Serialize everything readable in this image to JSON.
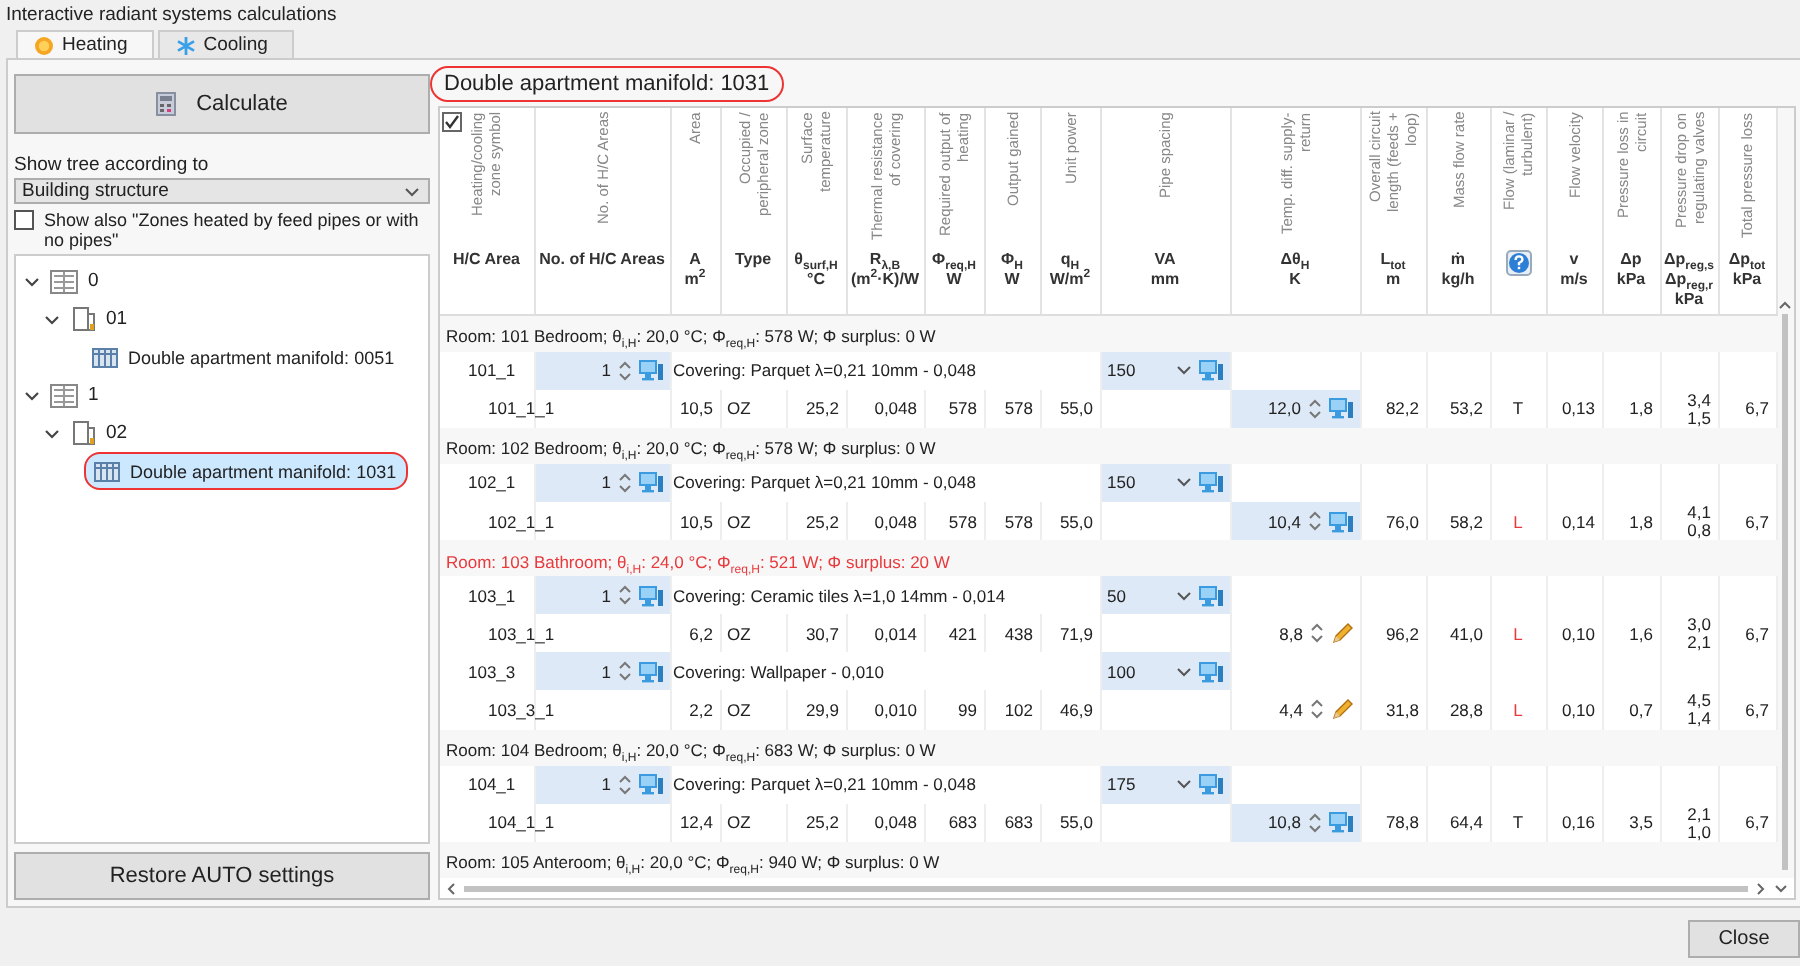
{
  "window": {
    "title": "Interactive radiant systems calculations"
  },
  "tabs": [
    {
      "label": "Heating",
      "kind": "heating",
      "selected": true
    },
    {
      "label": "Cooling",
      "kind": "cooling",
      "selected": false
    }
  ],
  "left_panel": {
    "calculate_button": "Calculate",
    "tree_mode_label": "Show tree according to",
    "tree_mode": "Building structure",
    "show_also": {
      "label": "Show also \"Zones heated by feed pipes or with no pipes\"",
      "checked": false
    },
    "tree": [
      {
        "label": "0",
        "expanded": true,
        "selected": false,
        "circled": false,
        "children": [
          {
            "label": "01",
            "expanded": true,
            "selected": false,
            "circled": false,
            "children": [
              {
                "label": "Double apartment manifold: 0051",
                "selected": false,
                "circled": false
              }
            ]
          }
        ]
      },
      {
        "label": "1",
        "expanded": true,
        "selected": false,
        "circled": false,
        "children": [
          {
            "label": "02",
            "expanded": true,
            "selected": false,
            "circled": false,
            "children": [
              {
                "label": "Double apartment manifold: 1031",
                "selected": true,
                "circled": true
              }
            ]
          }
        ]
      }
    ],
    "restore_button": "Restore AUTO settings"
  },
  "manifold_title": {
    "text": "Double apartment manifold: 1031",
    "circled": true
  },
  "table": {
    "select_all_checked": true,
    "columns": [
      {
        "caption": "Heating/cooling zone symbol",
        "kind": "text",
        "symbol": [
          "H/C Area"
        ]
      },
      {
        "caption": "No. of H/C Areas",
        "kind": "text",
        "symbol": [
          "No. of H/C Areas"
        ]
      },
      {
        "caption": "Area",
        "kind": "text",
        "symbol": [
          "A",
          "m$^{2}$"
        ]
      },
      {
        "caption": "Occupied / peripheral zone",
        "kind": "text",
        "symbol": [
          "Type"
        ]
      },
      {
        "caption": "Surface temperature",
        "kind": "text",
        "symbol": [
          "θ$_{surf,H}$",
          "°C"
        ]
      },
      {
        "caption": "Thermal resistance of covering",
        "kind": "text",
        "symbol": [
          "R$_{λ,B}$",
          "(m$^{2}$·K)/W"
        ]
      },
      {
        "caption": "Required output of heating",
        "kind": "text",
        "symbol": [
          "Φ$_{req,H}$",
          "W"
        ]
      },
      {
        "caption": "Output gained",
        "kind": "text",
        "symbol": [
          "Φ$_{H}$",
          "W"
        ]
      },
      {
        "caption": "Unit power",
        "kind": "text",
        "symbol": [
          "q$_{H}$",
          "W/m$^{2}$"
        ]
      },
      {
        "caption": "Pipe spacing",
        "kind": "text",
        "symbol": [
          "VA",
          "mm"
        ]
      },
      {
        "caption": "Temp. diff. supply-return",
        "kind": "text",
        "symbol": [
          "Δθ$_{H}$",
          "K"
        ]
      },
      {
        "caption": "Overall circuit length (feeds + loop)",
        "kind": "text",
        "symbol": [
          "L$_{tot}$",
          "m"
        ]
      },
      {
        "caption": "Mass flow rate",
        "kind": "text",
        "symbol": [
          "ṁ",
          "kg/h"
        ]
      },
      {
        "caption": "Flow (laminar / turbulent)",
        "kind": "icon"
      },
      {
        "caption": "Flow velocity",
        "kind": "text",
        "symbol": [
          "v",
          "m/s"
        ]
      },
      {
        "caption": "Pressure loss in circuit",
        "kind": "text",
        "symbol": [
          "Δp",
          "kPa"
        ]
      },
      {
        "caption": "Pressure drop on regulating valves",
        "kind": "text",
        "symbol": [
          "Δp$_{reg,s}$",
          "Δp$_{reg,r}$",
          "kPa"
        ]
      },
      {
        "caption": "Total pressure loss",
        "kind": "text",
        "symbol": [
          "Δp$_{tot}$",
          "kPa"
        ]
      }
    ],
    "rooms": [
      {
        "header": "Room: 101 Bedroom; θ$_{i,H}$: 20,0 °C; Φ$_{req,H}$: 578 W; Φ surplus: 0 W",
        "warning": false,
        "areas": [
          {
            "name": "101_1",
            "count": "1",
            "covering": "Covering: Parquet λ=0,21 10mm - 0,048",
            "pipe_spacing": "150",
            "circuit": {
              "name": "101_1_1",
              "area": "10,5",
              "type": "OZ",
              "surf_temp": "25,2",
              "resistance": "0,048",
              "required": "578",
              "gained": "578",
              "unit_power": "55,0",
              "temp_diff": "12,0",
              "temp_diff_manual": false,
              "length": "82,2",
              "mass_flow": "53,2",
              "flow": "T",
              "flow_warning": false,
              "velocity": "0,13",
              "pressure_loss": "1,8",
              "valve_drop": [
                "3,4",
                "1,5"
              ],
              "total_loss": "6,7"
            }
          }
        ]
      },
      {
        "header": "Room: 102 Bedroom; θ$_{i,H}$: 20,0 °C; Φ$_{req,H}$: 578 W; Φ surplus: 0 W",
        "warning": false,
        "areas": [
          {
            "name": "102_1",
            "count": "1",
            "covering": "Covering: Parquet λ=0,21 10mm - 0,048",
            "pipe_spacing": "150",
            "circuit": {
              "name": "102_1_1",
              "area": "10,5",
              "type": "OZ",
              "surf_temp": "25,2",
              "resistance": "0,048",
              "required": "578",
              "gained": "578",
              "unit_power": "55,0",
              "temp_diff": "10,4",
              "temp_diff_manual": false,
              "length": "76,0",
              "mass_flow": "58,2",
              "flow": "L",
              "flow_warning": true,
              "velocity": "0,14",
              "pressure_loss": "1,8",
              "valve_drop": [
                "4,1",
                "0,8"
              ],
              "total_loss": "6,7"
            }
          }
        ]
      },
      {
        "header": "Room: 103 Bathroom; θ$_{i,H}$: 24,0 °C; Φ$_{req,H}$: 521 W; Φ surplus: 20 W",
        "warning": true,
        "areas": [
          {
            "name": "103_1",
            "count": "1",
            "covering": "Covering: Ceramic tiles λ=1,0 14mm - 0,014",
            "pipe_spacing": "50",
            "circuit": {
              "name": "103_1_1",
              "area": "6,2",
              "type": "OZ",
              "surf_temp": "30,7",
              "resistance": "0,014",
              "required": "421",
              "gained": "438",
              "unit_power": "71,9",
              "temp_diff": "8,8",
              "temp_diff_manual": true,
              "length": "96,2",
              "mass_flow": "41,0",
              "flow": "L",
              "flow_warning": true,
              "velocity": "0,10",
              "pressure_loss": "1,6",
              "valve_drop": [
                "3,0",
                "2,1"
              ],
              "total_loss": "6,7"
            }
          },
          {
            "name": "103_3",
            "count": "1",
            "covering": "Covering: Wallpaper - 0,010",
            "pipe_spacing": "100",
            "circuit": {
              "name": "103_3_1",
              "area": "2,2",
              "type": "OZ",
              "surf_temp": "29,9",
              "resistance": "0,010",
              "required": "99",
              "gained": "102",
              "unit_power": "46,9",
              "temp_diff": "4,4",
              "temp_diff_manual": true,
              "length": "31,8",
              "mass_flow": "28,8",
              "flow": "L",
              "flow_warning": true,
              "velocity": "0,10",
              "pressure_loss": "0,7",
              "valve_drop": [
                "4,5",
                "1,4"
              ],
              "total_loss": "6,7"
            }
          }
        ]
      },
      {
        "header": "Room: 104 Bedroom; θ$_{i,H}$: 20,0 °C; Φ$_{req,H}$: 683 W; Φ surplus: 0 W",
        "warning": false,
        "areas": [
          {
            "name": "104_1",
            "count": "1",
            "covering": "Covering: Parquet λ=0,21 10mm - 0,048",
            "pipe_spacing": "175",
            "circuit": {
              "name": "104_1_1",
              "area": "12,4",
              "type": "OZ",
              "surf_temp": "25,2",
              "resistance": "0,048",
              "required": "683",
              "gained": "683",
              "unit_power": "55,0",
              "temp_diff": "10,8",
              "temp_diff_manual": false,
              "length": "78,8",
              "mass_flow": "64,4",
              "flow": "T",
              "flow_warning": false,
              "velocity": "0,16",
              "pressure_loss": "3,5",
              "valve_drop": [
                "2,1",
                "1,0"
              ],
              "total_loss": "6,7"
            }
          }
        ]
      },
      {
        "header": "Room: 105 Anteroom; θ$_{i,H}$: 20,0 °C; Φ$_{req,H}$: 940 W; Φ surplus: 0 W",
        "warning": false
      }
    ]
  },
  "buttons": [
    {
      "label": "Close"
    }
  ]
}
